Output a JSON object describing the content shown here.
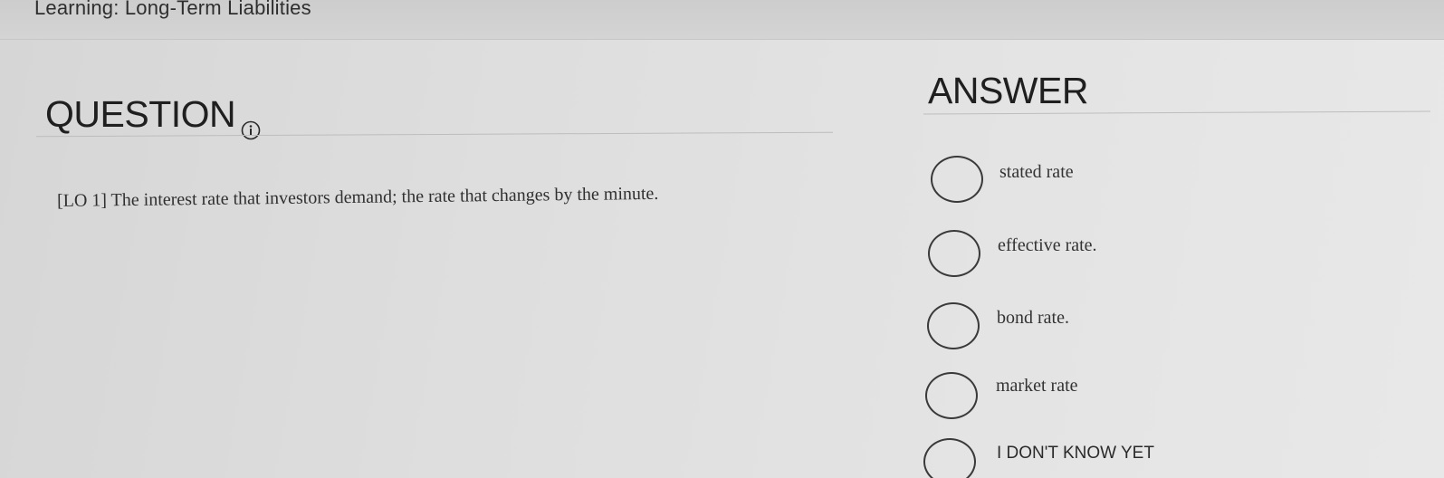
{
  "header": {
    "title": "Learning: Long-Term Liabilities"
  },
  "question": {
    "heading": "QUESTION",
    "text": "[LO 1] The interest rate that investors demand; the rate that changes by the minute."
  },
  "answer": {
    "heading": "ANSWER",
    "options": [
      {
        "label": "stated rate"
      },
      {
        "label": "effective rate."
      },
      {
        "label": "bond rate."
      },
      {
        "label": "market rate"
      },
      {
        "label": "I DON'T KNOW YET"
      }
    ]
  }
}
